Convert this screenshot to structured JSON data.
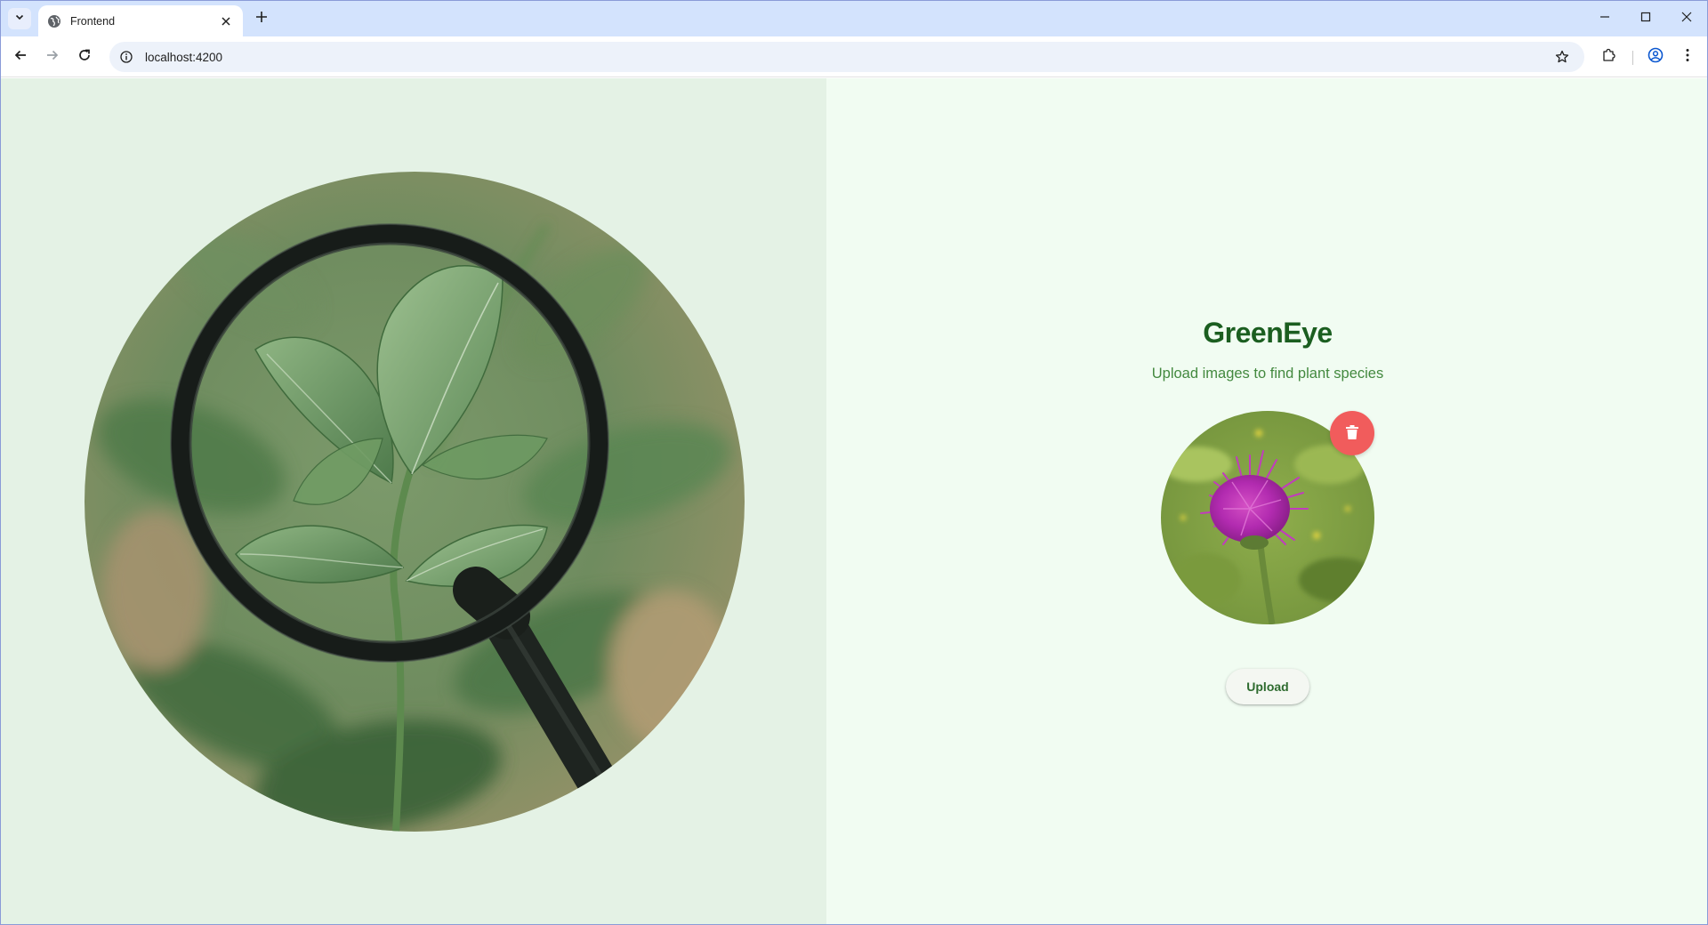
{
  "browser": {
    "tab": {
      "title": "Frontend",
      "favicon": "globe-icon"
    },
    "omnibox": {
      "url": "localhost:4200"
    },
    "icons": {
      "tab_search": "chevron-down-icon",
      "tab_close": "close-icon",
      "new_tab": "plus-icon",
      "back": "arrow-left-icon",
      "forward": "arrow-right-icon",
      "reload": "reload-icon",
      "site_info": "info-icon",
      "bookmark": "star-icon",
      "extensions": "puzzle-icon",
      "profile": "account-icon",
      "menu": "kebab-menu-icon",
      "minimize": "minimize-icon",
      "maximize": "maximize-icon",
      "close": "close-icon"
    }
  },
  "app": {
    "title": "GreenEye",
    "subtitle": "Upload images to find plant species",
    "upload_label": "Upload",
    "delete_icon": "trash-icon",
    "hero_image": "magnifying-glass-over-leaves",
    "preview_image": "purple-thistle-flower",
    "colors": {
      "left_panel_bg": "#e4f2e5",
      "right_panel_bg": "#f1fcf2",
      "title": "#1b5e20",
      "subtitle": "#43893f",
      "delete_button": "#f15c5c",
      "upload_text": "#2e6b2f"
    }
  }
}
